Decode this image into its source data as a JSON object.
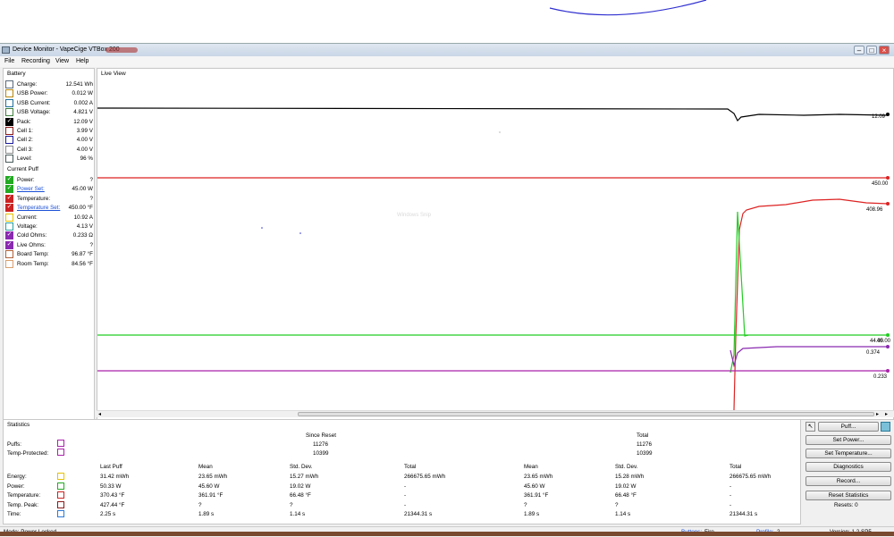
{
  "window": {
    "title": "Device Monitor - VapeCige VTBox 200",
    "minimize_icon": "minimize-icon",
    "maximize_icon": "maximize-icon",
    "close_icon": "close-icon"
  },
  "menu": [
    "File",
    "Recording",
    "View",
    "Help"
  ],
  "battery": {
    "title": "Battery",
    "rows": [
      {
        "label": "Charge:",
        "value": "12.541 Wh",
        "color": "#5a6a7a",
        "checked": false,
        "link": false
      },
      {
        "label": "USB Power:",
        "value": "0.012 W",
        "color": "#b8860b",
        "checked": false,
        "link": false
      },
      {
        "label": "USB Current:",
        "value": "0.002 A",
        "color": "#1f6f9f",
        "checked": false,
        "link": false
      },
      {
        "label": "USB Voltage:",
        "value": "4.821 V",
        "color": "#3f7f3f",
        "checked": false,
        "link": false
      },
      {
        "label": "Pack:",
        "value": "12.09 V",
        "color": "#000000",
        "checked": true,
        "link": false
      },
      {
        "label": "Cell 1:",
        "value": "3.99 V",
        "color": "#8b1a1a",
        "checked": false,
        "link": false
      },
      {
        "label": "Cell 2:",
        "value": "4.00 V",
        "color": "#1a1a9b",
        "checked": false,
        "link": false
      },
      {
        "label": "Cell 3:",
        "value": "4.00 V",
        "color": "#8a8a8a",
        "checked": false,
        "link": false
      },
      {
        "label": "Level:",
        "value": "96 %",
        "color": "#4a5a5a",
        "checked": false,
        "link": false
      }
    ]
  },
  "current_puff": {
    "title": "Current Puff",
    "rows": [
      {
        "label": "Power:",
        "value": "?",
        "color": "#22aa22",
        "checked": true,
        "link": false
      },
      {
        "label": "Power Set:",
        "value": "45.00 W",
        "color": "#22aa22",
        "checked": true,
        "link": true
      },
      {
        "label": "Temperature:",
        "value": "?",
        "color": "#cc2222",
        "checked": true,
        "link": false
      },
      {
        "label": "Temperature Set:",
        "value": "450.00 °F",
        "color": "#cc2222",
        "checked": true,
        "link": true
      },
      {
        "label": "Current:",
        "value": "10.92 A",
        "color": "#e6c200",
        "checked": false,
        "link": false
      },
      {
        "label": "Voltage:",
        "value": "4.13 V",
        "color": "#2aa0a0",
        "checked": false,
        "link": false
      },
      {
        "label": "Cold Ohms:",
        "value": "0.233 Ω",
        "color": "#8a2ab0",
        "checked": true,
        "link": false
      },
      {
        "label": "Live Ohms:",
        "value": "?",
        "color": "#8a2ab0",
        "checked": true,
        "link": false
      },
      {
        "label": "Board Temp:",
        "value": "96.87 °F",
        "color": "#b0603a",
        "checked": false,
        "link": false
      },
      {
        "label": "Room Temp:",
        "value": "84.56 °F",
        "color": "#d8a070",
        "checked": false,
        "link": false
      }
    ]
  },
  "live_view": {
    "title": "Live View",
    "watermark": "Windows Snip",
    "end_labels": [
      "12.09",
      "450.00",
      "408.96",
      "44.00",
      "45.00",
      "0.374",
      "0.233"
    ]
  },
  "statistics": {
    "title": "Statistics",
    "since_reset": "Since Reset",
    "total": "Total",
    "puffs_label": "Puffs:",
    "temp_protected_label": "Temp-Protected:",
    "puffs_since": "11276",
    "puffs_total": "11276",
    "tp_since": "10399",
    "tp_total": "10399",
    "headers": [
      "Last Puff",
      "Mean",
      "Std. Dev.",
      "Total",
      "Mean",
      "Std. Dev.",
      "Total"
    ],
    "rows": [
      {
        "label": "Energy:",
        "color": "#e6c200",
        "cells": [
          "31.42 mWh",
          "23.65 mWh",
          "15.27 mWh",
          "266675.65 mWh",
          "23.65 mWh",
          "15.28 mWh",
          "266675.65 mWh"
        ]
      },
      {
        "label": "Power:",
        "color": "#22aa22",
        "cells": [
          "50.33 W",
          "45.60 W",
          "19.02 W",
          "-",
          "45.60 W",
          "19.02 W",
          "-"
        ]
      },
      {
        "label": "Temperature:",
        "color": "#cc2222",
        "cells": [
          "370.43 °F",
          "361.91 °F",
          "66.48 °F",
          "-",
          "361.91 °F",
          "66.48 °F",
          "-"
        ]
      },
      {
        "label": "Temp. Peak:",
        "color": "#8b1a1a",
        "cells": [
          "427.44 °F",
          "?",
          "?",
          "-",
          "?",
          "?",
          "-"
        ]
      },
      {
        "label": "Time:",
        "color": "#2a7ad8",
        "cells": [
          "2.25 s",
          "1.89 s",
          "1.14 s",
          "21344.31 s",
          "1.89 s",
          "1.14 s",
          "21344.31 s"
        ]
      }
    ]
  },
  "buttons": {
    "puff": "Puff...",
    "set_power": "Set Power...",
    "set_temperature": "Set Temperature...",
    "diagnostics": "Diagnostics",
    "record": "Record...",
    "reset_statistics": "Reset Statistics",
    "resets": "Resets: 0",
    "cursor_icon": "pointer-icon",
    "refresh_icon": "device-icon"
  },
  "status": {
    "mode": "Mode: Power Locked",
    "buttons_label": "Buttons:",
    "buttons_value": "Fire",
    "profile_label": "Profile:",
    "profile_value": "2",
    "version": "Version: 1.2 SP5"
  }
}
